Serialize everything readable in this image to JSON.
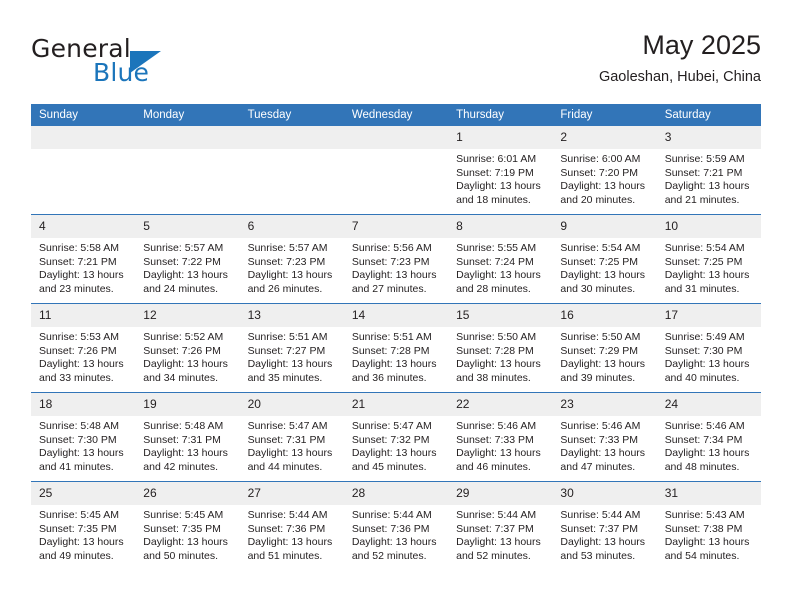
{
  "brand": {
    "name_part1": "General",
    "name_part2": "Blue",
    "triangle_color": "#1b75bb"
  },
  "header": {
    "title": "May 2025",
    "subtitle": "Gaoleshan, Hubei, China"
  },
  "theme": {
    "header_bg": "#3275b8",
    "daynum_bg": "#efefef",
    "text": "#231f20"
  },
  "weekday_headers": [
    "Sunday",
    "Monday",
    "Tuesday",
    "Wednesday",
    "Thursday",
    "Friday",
    "Saturday"
  ],
  "weeks": [
    [
      {
        "day": "",
        "empty": true,
        "sunrise": "",
        "sunset": "",
        "daylight_line1": "",
        "daylight_line2": ""
      },
      {
        "day": "",
        "empty": true,
        "sunrise": "",
        "sunset": "",
        "daylight_line1": "",
        "daylight_line2": ""
      },
      {
        "day": "",
        "empty": true,
        "sunrise": "",
        "sunset": "",
        "daylight_line1": "",
        "daylight_line2": ""
      },
      {
        "day": "",
        "empty": true,
        "sunrise": "",
        "sunset": "",
        "daylight_line1": "",
        "daylight_line2": ""
      },
      {
        "day": "1",
        "empty": false,
        "sunrise": "Sunrise: 6:01 AM",
        "sunset": "Sunset: 7:19 PM",
        "daylight_line1": "Daylight: 13 hours",
        "daylight_line2": "and 18 minutes."
      },
      {
        "day": "2",
        "empty": false,
        "sunrise": "Sunrise: 6:00 AM",
        "sunset": "Sunset: 7:20 PM",
        "daylight_line1": "Daylight: 13 hours",
        "daylight_line2": "and 20 minutes."
      },
      {
        "day": "3",
        "empty": false,
        "sunrise": "Sunrise: 5:59 AM",
        "sunset": "Sunset: 7:21 PM",
        "daylight_line1": "Daylight: 13 hours",
        "daylight_line2": "and 21 minutes."
      }
    ],
    [
      {
        "day": "4",
        "empty": false,
        "sunrise": "Sunrise: 5:58 AM",
        "sunset": "Sunset: 7:21 PM",
        "daylight_line1": "Daylight: 13 hours",
        "daylight_line2": "and 23 minutes."
      },
      {
        "day": "5",
        "empty": false,
        "sunrise": "Sunrise: 5:57 AM",
        "sunset": "Sunset: 7:22 PM",
        "daylight_line1": "Daylight: 13 hours",
        "daylight_line2": "and 24 minutes."
      },
      {
        "day": "6",
        "empty": false,
        "sunrise": "Sunrise: 5:57 AM",
        "sunset": "Sunset: 7:23 PM",
        "daylight_line1": "Daylight: 13 hours",
        "daylight_line2": "and 26 minutes."
      },
      {
        "day": "7",
        "empty": false,
        "sunrise": "Sunrise: 5:56 AM",
        "sunset": "Sunset: 7:23 PM",
        "daylight_line1": "Daylight: 13 hours",
        "daylight_line2": "and 27 minutes."
      },
      {
        "day": "8",
        "empty": false,
        "sunrise": "Sunrise: 5:55 AM",
        "sunset": "Sunset: 7:24 PM",
        "daylight_line1": "Daylight: 13 hours",
        "daylight_line2": "and 28 minutes."
      },
      {
        "day": "9",
        "empty": false,
        "sunrise": "Sunrise: 5:54 AM",
        "sunset": "Sunset: 7:25 PM",
        "daylight_line1": "Daylight: 13 hours",
        "daylight_line2": "and 30 minutes."
      },
      {
        "day": "10",
        "empty": false,
        "sunrise": "Sunrise: 5:54 AM",
        "sunset": "Sunset: 7:25 PM",
        "daylight_line1": "Daylight: 13 hours",
        "daylight_line2": "and 31 minutes."
      }
    ],
    [
      {
        "day": "11",
        "empty": false,
        "sunrise": "Sunrise: 5:53 AM",
        "sunset": "Sunset: 7:26 PM",
        "daylight_line1": "Daylight: 13 hours",
        "daylight_line2": "and 33 minutes."
      },
      {
        "day": "12",
        "empty": false,
        "sunrise": "Sunrise: 5:52 AM",
        "sunset": "Sunset: 7:26 PM",
        "daylight_line1": "Daylight: 13 hours",
        "daylight_line2": "and 34 minutes."
      },
      {
        "day": "13",
        "empty": false,
        "sunrise": "Sunrise: 5:51 AM",
        "sunset": "Sunset: 7:27 PM",
        "daylight_line1": "Daylight: 13 hours",
        "daylight_line2": "and 35 minutes."
      },
      {
        "day": "14",
        "empty": false,
        "sunrise": "Sunrise: 5:51 AM",
        "sunset": "Sunset: 7:28 PM",
        "daylight_line1": "Daylight: 13 hours",
        "daylight_line2": "and 36 minutes."
      },
      {
        "day": "15",
        "empty": false,
        "sunrise": "Sunrise: 5:50 AM",
        "sunset": "Sunset: 7:28 PM",
        "daylight_line1": "Daylight: 13 hours",
        "daylight_line2": "and 38 minutes."
      },
      {
        "day": "16",
        "empty": false,
        "sunrise": "Sunrise: 5:50 AM",
        "sunset": "Sunset: 7:29 PM",
        "daylight_line1": "Daylight: 13 hours",
        "daylight_line2": "and 39 minutes."
      },
      {
        "day": "17",
        "empty": false,
        "sunrise": "Sunrise: 5:49 AM",
        "sunset": "Sunset: 7:30 PM",
        "daylight_line1": "Daylight: 13 hours",
        "daylight_line2": "and 40 minutes."
      }
    ],
    [
      {
        "day": "18",
        "empty": false,
        "sunrise": "Sunrise: 5:48 AM",
        "sunset": "Sunset: 7:30 PM",
        "daylight_line1": "Daylight: 13 hours",
        "daylight_line2": "and 41 minutes."
      },
      {
        "day": "19",
        "empty": false,
        "sunrise": "Sunrise: 5:48 AM",
        "sunset": "Sunset: 7:31 PM",
        "daylight_line1": "Daylight: 13 hours",
        "daylight_line2": "and 42 minutes."
      },
      {
        "day": "20",
        "empty": false,
        "sunrise": "Sunrise: 5:47 AM",
        "sunset": "Sunset: 7:31 PM",
        "daylight_line1": "Daylight: 13 hours",
        "daylight_line2": "and 44 minutes."
      },
      {
        "day": "21",
        "empty": false,
        "sunrise": "Sunrise: 5:47 AM",
        "sunset": "Sunset: 7:32 PM",
        "daylight_line1": "Daylight: 13 hours",
        "daylight_line2": "and 45 minutes."
      },
      {
        "day": "22",
        "empty": false,
        "sunrise": "Sunrise: 5:46 AM",
        "sunset": "Sunset: 7:33 PM",
        "daylight_line1": "Daylight: 13 hours",
        "daylight_line2": "and 46 minutes."
      },
      {
        "day": "23",
        "empty": false,
        "sunrise": "Sunrise: 5:46 AM",
        "sunset": "Sunset: 7:33 PM",
        "daylight_line1": "Daylight: 13 hours",
        "daylight_line2": "and 47 minutes."
      },
      {
        "day": "24",
        "empty": false,
        "sunrise": "Sunrise: 5:46 AM",
        "sunset": "Sunset: 7:34 PM",
        "daylight_line1": "Daylight: 13 hours",
        "daylight_line2": "and 48 minutes."
      }
    ],
    [
      {
        "day": "25",
        "empty": false,
        "sunrise": "Sunrise: 5:45 AM",
        "sunset": "Sunset: 7:35 PM",
        "daylight_line1": "Daylight: 13 hours",
        "daylight_line2": "and 49 minutes."
      },
      {
        "day": "26",
        "empty": false,
        "sunrise": "Sunrise: 5:45 AM",
        "sunset": "Sunset: 7:35 PM",
        "daylight_line1": "Daylight: 13 hours",
        "daylight_line2": "and 50 minutes."
      },
      {
        "day": "27",
        "empty": false,
        "sunrise": "Sunrise: 5:44 AM",
        "sunset": "Sunset: 7:36 PM",
        "daylight_line1": "Daylight: 13 hours",
        "daylight_line2": "and 51 minutes."
      },
      {
        "day": "28",
        "empty": false,
        "sunrise": "Sunrise: 5:44 AM",
        "sunset": "Sunset: 7:36 PM",
        "daylight_line1": "Daylight: 13 hours",
        "daylight_line2": "and 52 minutes."
      },
      {
        "day": "29",
        "empty": false,
        "sunrise": "Sunrise: 5:44 AM",
        "sunset": "Sunset: 7:37 PM",
        "daylight_line1": "Daylight: 13 hours",
        "daylight_line2": "and 52 minutes."
      },
      {
        "day": "30",
        "empty": false,
        "sunrise": "Sunrise: 5:44 AM",
        "sunset": "Sunset: 7:37 PM",
        "daylight_line1": "Daylight: 13 hours",
        "daylight_line2": "and 53 minutes."
      },
      {
        "day": "31",
        "empty": false,
        "sunrise": "Sunrise: 5:43 AM",
        "sunset": "Sunset: 7:38 PM",
        "daylight_line1": "Daylight: 13 hours",
        "daylight_line2": "and 54 minutes."
      }
    ]
  ]
}
